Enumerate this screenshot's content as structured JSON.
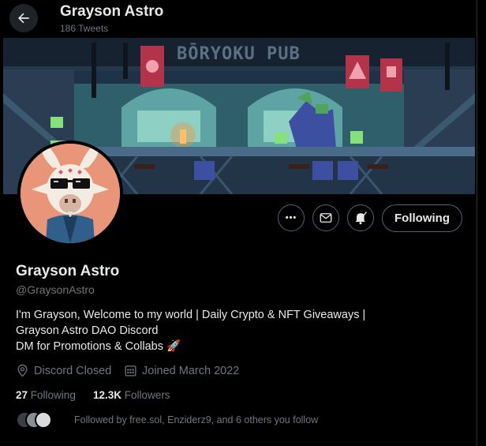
{
  "header": {
    "title": "Grayson Astro",
    "tweet_count": "186 Tweets"
  },
  "banner": {
    "sign_text": "BŌRYOKU PUB"
  },
  "actions": {
    "more_label": "•••",
    "following_label": "Following"
  },
  "profile": {
    "name": "Grayson Astro",
    "handle": "@GraysonAstro",
    "bio": [
      "I'm Grayson, Welcome to my world | Daily Crypto & NFT Giveaways |",
      "Grayson Astro DAO Discord",
      "DM for Promotions & Collabs 🚀"
    ],
    "location": "Discord Closed",
    "joined": "Joined March 2022",
    "following_count": "27",
    "following_label": "Following",
    "followers_count": "12.3K",
    "followers_label": "Followers",
    "followed_by": "Followed by free.sol, Enziderz9, and 6 others you follow"
  },
  "colors": {
    "background": "#000000",
    "text": "#e7e9ea",
    "muted": "#71767b",
    "border": "#536471",
    "avatar_bg": "#e9957a"
  }
}
